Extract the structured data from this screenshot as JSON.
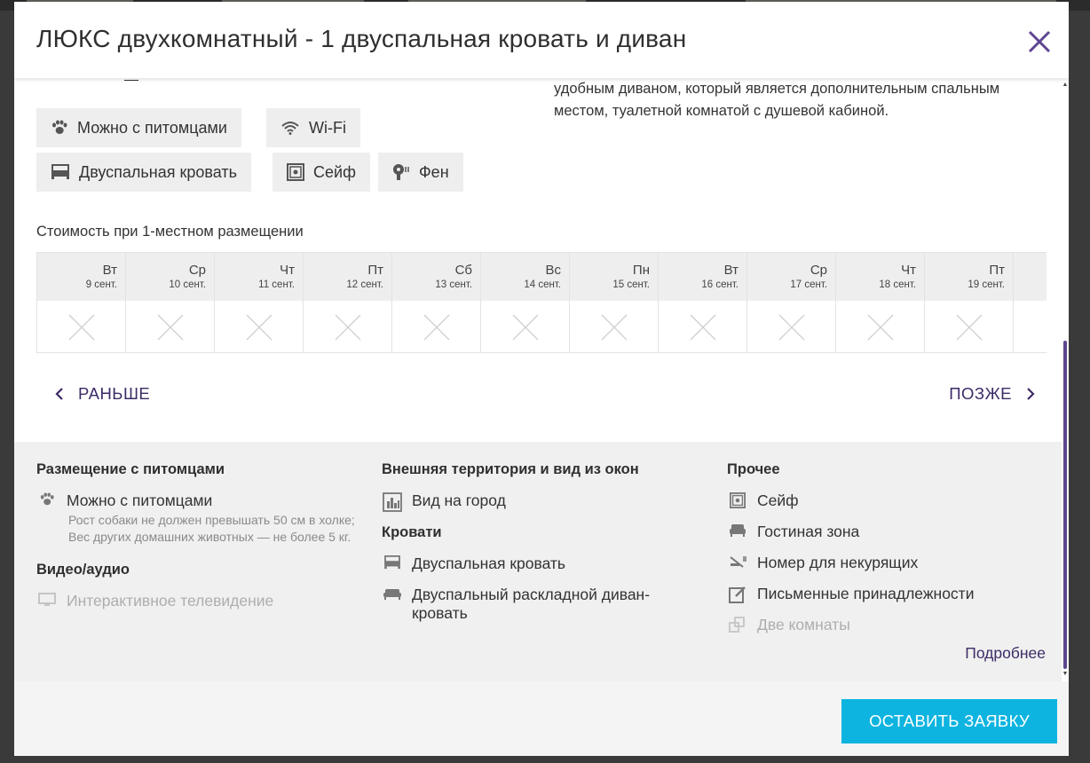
{
  "modal": {
    "title": "ЛЮКС двухкомнатный - 1 двуспальная кровать и диван",
    "close_icon": "close-icon"
  },
  "description": {
    "text": "удобным диваном, который является дополнительным спальным местом, туалетной комнатой с душевой кабиной."
  },
  "amenity_chips": [
    {
      "label": "Можно с питомцами",
      "icon": "paw-icon"
    },
    {
      "label": "Wi-Fi",
      "icon": "wifi-icon"
    },
    {
      "label": "Двуспальная кровать",
      "icon": "bed-icon"
    },
    {
      "label": "Сейф",
      "icon": "safe-icon"
    },
    {
      "label": "Фен",
      "icon": "hairdryer-icon"
    }
  ],
  "pricing": {
    "label": "Стоимость при 1-местном размещении",
    "days": [
      {
        "dow": "Вт",
        "date": "9 сент."
      },
      {
        "dow": "Ср",
        "date": "10 сент."
      },
      {
        "dow": "Чт",
        "date": "11 сент."
      },
      {
        "dow": "Пт",
        "date": "12 сент."
      },
      {
        "dow": "Сб",
        "date": "13 сент."
      },
      {
        "dow": "Вс",
        "date": "14 сент."
      },
      {
        "dow": "Пн",
        "date": "15 сент."
      },
      {
        "dow": "Вт",
        "date": "16 сент."
      },
      {
        "dow": "Ср",
        "date": "17 сент."
      },
      {
        "dow": "Чт",
        "date": "18 сент."
      },
      {
        "dow": "Пт",
        "date": "19 сент."
      }
    ],
    "prev_label": "РАНЬШЕ",
    "next_label": "ПОЗЖЕ"
  },
  "features": {
    "pets": {
      "heading": "Размещение с питомцами",
      "item": "Можно с питомцами",
      "note": "Рост собаки не должен превышать 50 см в холке; Вес других домашних животных — не более 5 кг."
    },
    "video": {
      "heading": "Видео/аудио",
      "item": "Интерактивное телевидение"
    },
    "outside": {
      "heading": "Внешняя территория и вид из окон",
      "item": "Вид на город"
    },
    "beds": {
      "heading": "Кровати",
      "items": [
        "Двуспальная кровать",
        "Двуспальный раскладной диван-кровать"
      ]
    },
    "other": {
      "heading": "Прочее",
      "items": [
        "Сейф",
        "Гостиная зона",
        "Номер для некурящих",
        "Письменные принадлежности",
        "Две комнаты"
      ]
    },
    "more_label": "Подробнее"
  },
  "footer": {
    "submit_label": "ОСТАВИТЬ ЗАЯВКУ"
  },
  "colors": {
    "accent": "#3d2b67",
    "button": "#0eb4e0",
    "scroll_thumb": "#5e4590"
  }
}
